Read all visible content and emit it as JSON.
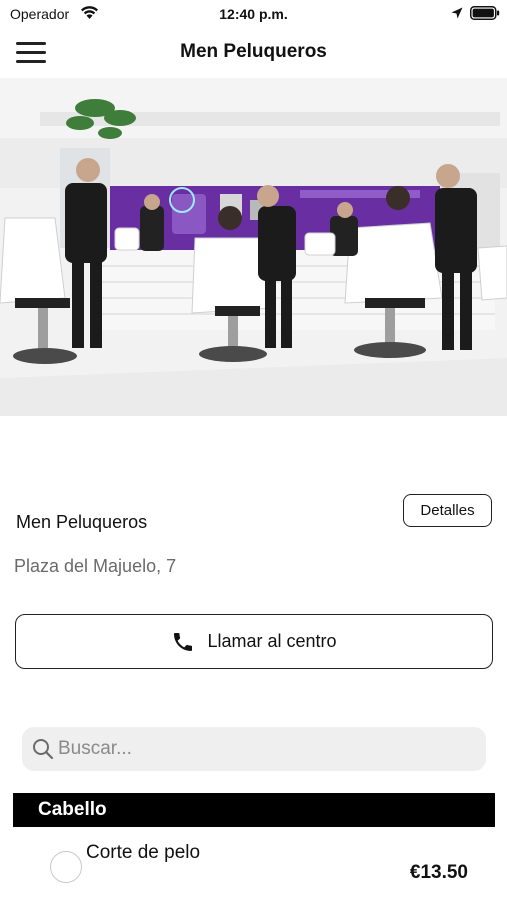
{
  "status_bar": {
    "carrier": "Operador",
    "time": "12:40 p.m."
  },
  "nav": {
    "title": "Men Peluqueros",
    "menu_icon": "hamburger-menu-icon"
  },
  "hero_image": {
    "description_icon": "salon-photo",
    "colors": {
      "accent_wall": "#6a2ea3",
      "floor": "#f4f4f4",
      "cape": "#ffffff",
      "chair": "#bdbdbd"
    }
  },
  "salon": {
    "name": "Men Peluqueros",
    "address": "Plaza del Majuelo, 7",
    "details_label": "Detalles"
  },
  "call": {
    "label": "Llamar al centro",
    "icon": "phone-icon"
  },
  "search": {
    "placeholder": "Buscar...",
    "value": "",
    "icon": "search-icon"
  },
  "categories": [
    {
      "label": "Cabello",
      "services": [
        {
          "name": "Corte de pelo",
          "price": "€13.50",
          "selected": false
        }
      ]
    }
  ]
}
